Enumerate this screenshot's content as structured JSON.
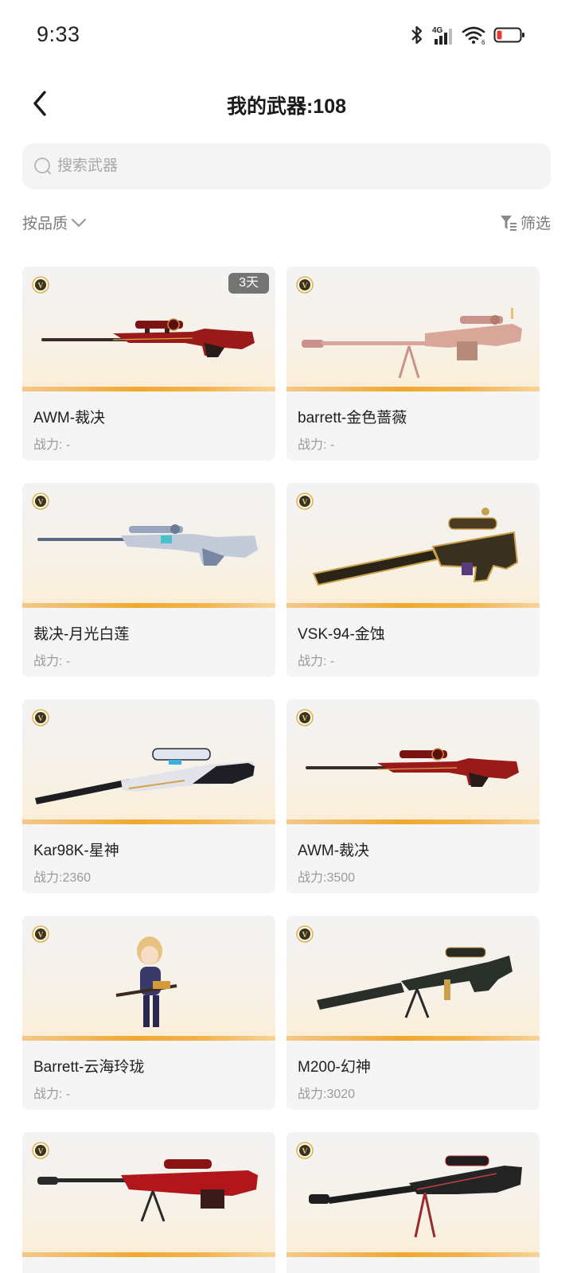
{
  "status_bar": {
    "time": "9:33",
    "icons": [
      "bluetooth-icon",
      "signal-4g-icon",
      "wifi-icon",
      "battery-low-icon"
    ],
    "network_label": "4G",
    "wifi_label": "6"
  },
  "header": {
    "title": "我的武器:108",
    "back_icon": "chevron-left-icon"
  },
  "search": {
    "placeholder": "搜索武器",
    "value": ""
  },
  "filters": {
    "sort_label": "按品质",
    "filter_label": "筛选"
  },
  "colors": {
    "accent_orange": "#f0a830",
    "card_bg": "#f5f5f6",
    "badge_gold": "#c9a04a",
    "muted_text": "#9a9a9e"
  },
  "weapons": [
    {
      "name": "AWM-裁决",
      "power": "战力: -",
      "tag": "3天",
      "art": "red-rifle"
    },
    {
      "name": "barrett-金色蔷薇",
      "power": "战力: -",
      "tag": "",
      "art": "pink-barrett"
    },
    {
      "name": "裁决-月光白莲",
      "power": "战力: -",
      "tag": "",
      "art": "white-rifle"
    },
    {
      "name": "VSK-94-金蚀",
      "power": "战力: -",
      "tag": "",
      "art": "gold-vsk"
    },
    {
      "name": "Kar98K-星神",
      "power": "战力:2360",
      "tag": "",
      "art": "kar98k"
    },
    {
      "name": "AWM-裁决",
      "power": "战力:3500",
      "tag": "",
      "art": "red-rifle"
    },
    {
      "name": "Barrett-云海玲珑",
      "power": "战力: -",
      "tag": "",
      "art": "character"
    },
    {
      "name": "M200-幻神",
      "power": "战力:3020",
      "tag": "",
      "art": "dark-m200"
    },
    {
      "name": "",
      "power": "",
      "tag": "",
      "art": "red-barrett"
    },
    {
      "name": "",
      "power": "",
      "tag": "",
      "art": "black-barrett"
    }
  ]
}
